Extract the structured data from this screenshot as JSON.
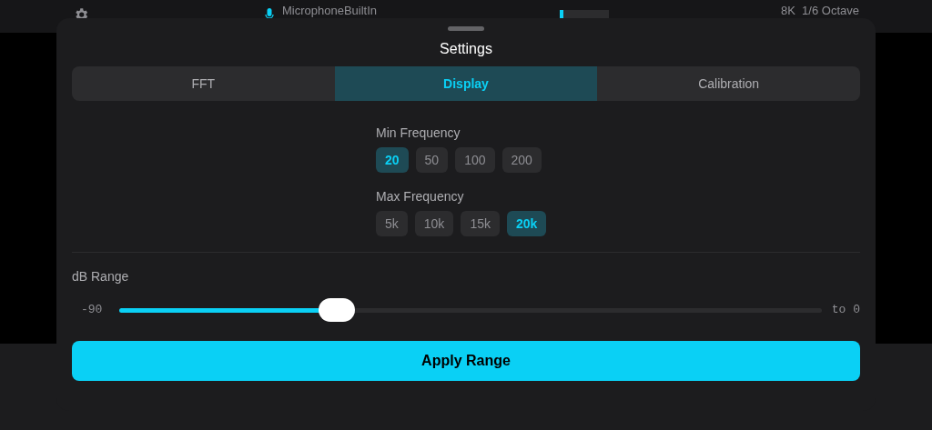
{
  "top_bar": {
    "input_name": "MicrophoneBuiltIn",
    "meter": {
      "level": 0.08
    },
    "info": "8K  1/6 Octave"
  },
  "sheet": {
    "title": "Settings",
    "tabs": [
      {
        "label": "FFT",
        "selected": false
      },
      {
        "label": "Display",
        "selected": true
      },
      {
        "label": "Calibration",
        "selected": false
      }
    ],
    "groups": [
      {
        "label": "Min Frequency",
        "options": [
          {
            "label": "20",
            "selected": true
          },
          {
            "label": "50",
            "selected": false
          },
          {
            "label": "100",
            "selected": false
          },
          {
            "label": "200",
            "selected": false
          }
        ]
      },
      {
        "label": "Max Frequency",
        "options": [
          {
            "label": "5k",
            "selected": false
          },
          {
            "label": "10k",
            "selected": false
          },
          {
            "label": "15k",
            "selected": false
          },
          {
            "label": "20k",
            "selected": true
          }
        ]
      }
    ],
    "db_range": {
      "label": "dB Range",
      "min_label": "-90",
      "max_label": "to 0",
      "level": 0.31
    },
    "apply_button": "Apply Range"
  }
}
